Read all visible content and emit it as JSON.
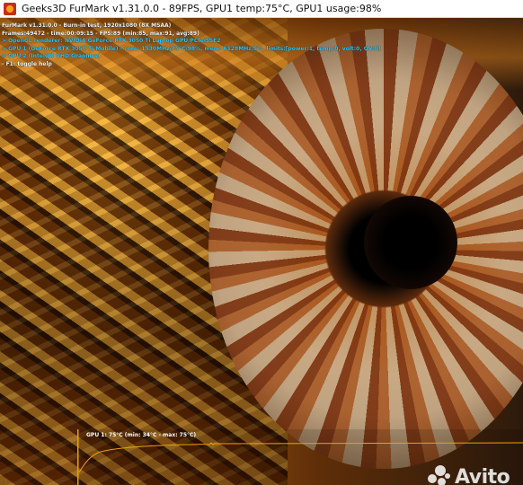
{
  "window": {
    "title": "Geeks3D FurMark v1.31.0.0 - 89FPS, GPU1 temp:75°C, GPU1 usage:98%",
    "icon": "furmark-app-icon"
  },
  "hud": {
    "lines": [
      {
        "text": "FurMark v1.31.0.0 - Burn-in test, 1920x1080 (8X MSAA)",
        "color": "#f4f4f4"
      },
      {
        "text": "Frames:49472 - time:00:09:15 - FPS:89 (min:85, max:91, avg:89)",
        "color": "#f4f4f4"
      },
      {
        "text": "> OpenGL renderer: NVIDIA GeForce RTX 3050 Ti Laptop GPU/PCIe/SSE2",
        "color": "#29c8ff"
      },
      {
        "text": "> GPU 1 (GeForce RTX 3050 Ti Mobile) - core: 1530MHz/75°C/98%, mem: 6128MHz/5%, limits:[power:1, temp:0, volt:0, OV:0]",
        "color": "#29c8ff"
      },
      {
        "text": "> GPU 2 (Intel(R) UHD Graphics)",
        "color": "#29c8ff"
      },
      {
        "text": "- F1: toggle help",
        "color": "#f4f4f4"
      }
    ]
  },
  "graph": {
    "label": "GPU 1: 75°C (min: 34°C - max: 75°C)",
    "line_color": "#f0a000",
    "current_temp_c": 75,
    "min_temp_c": 34,
    "max_temp_c": 75
  },
  "watermark": {
    "text": "Avito",
    "icon": "avito-dots-icon"
  }
}
